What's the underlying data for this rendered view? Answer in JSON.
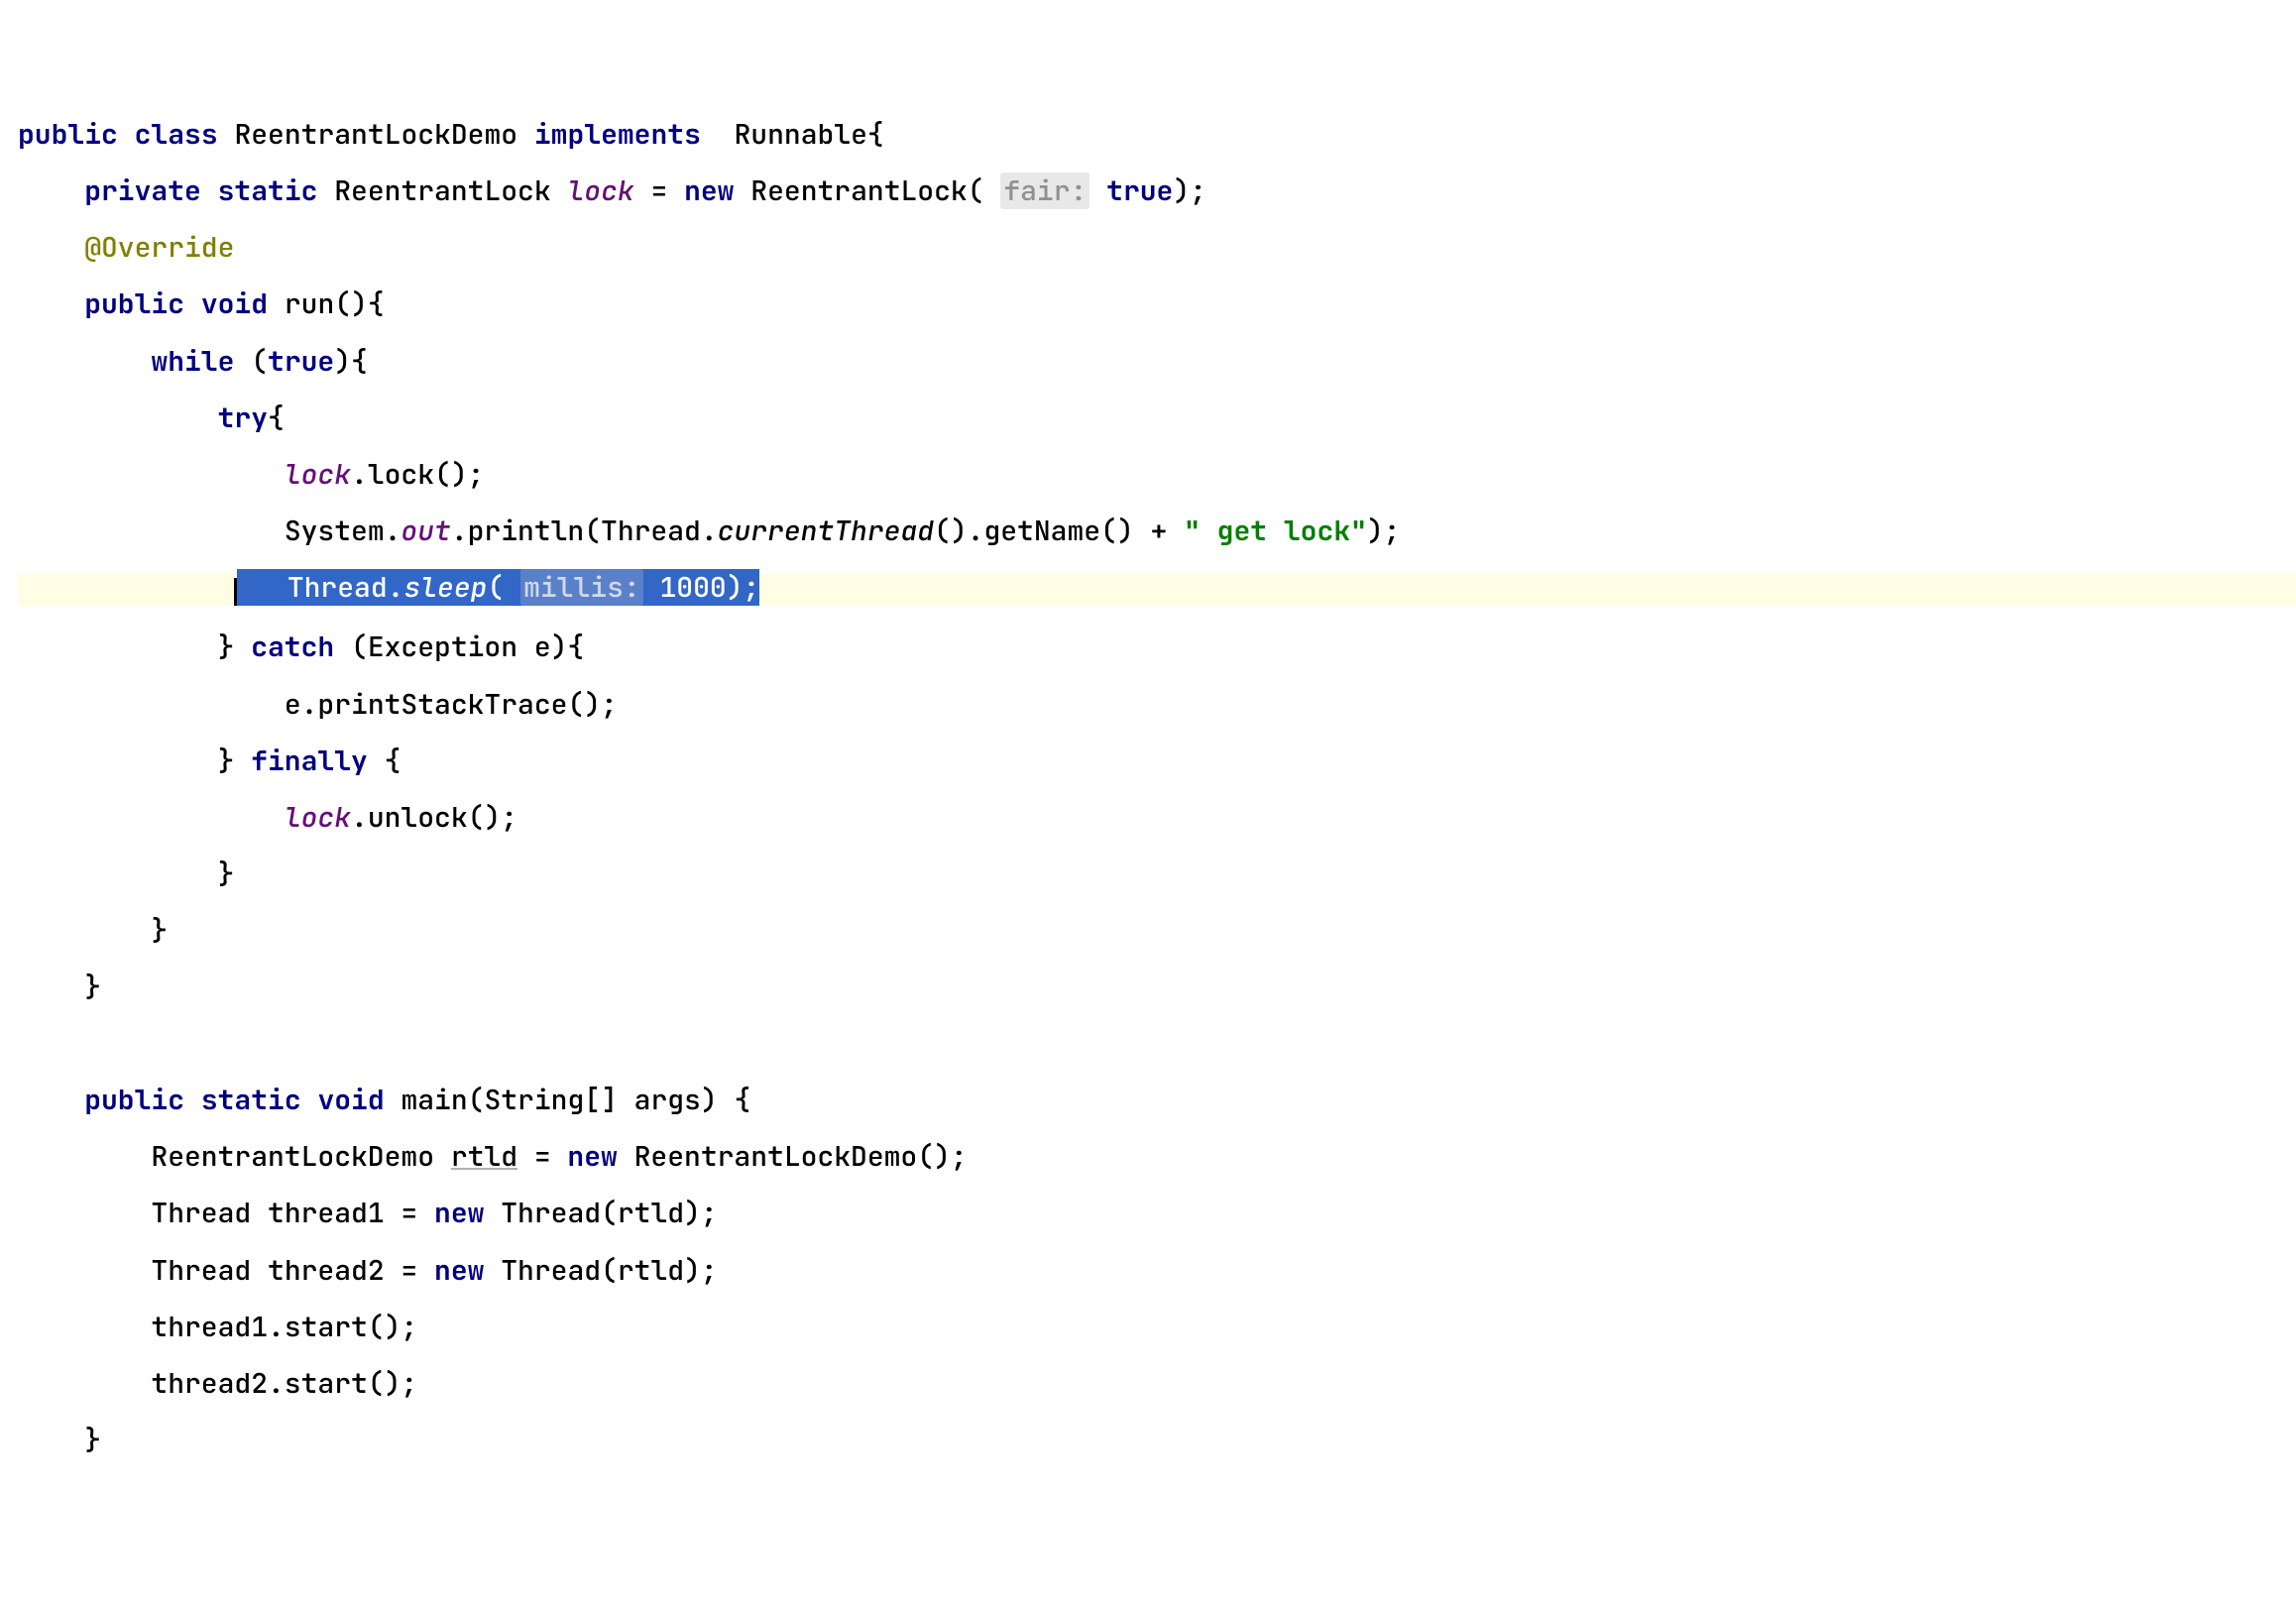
{
  "code": {
    "kw_public": "public",
    "kw_class": "class",
    "class_name": "ReentrantLockDemo",
    "kw_implements": "implements",
    "interface_name": "Runnable",
    "kw_private": "private",
    "kw_static": "static",
    "type_reentrantlock": "ReentrantLock",
    "field_lock": "lock",
    "eq": " = ",
    "kw_new": "new",
    "ctor_reentrantlock": "ReentrantLock",
    "hint_fair": "fair:",
    "val_true": "true",
    "annotation_override": "@Override",
    "kw_void": "void",
    "method_run": "run",
    "kw_while": "while",
    "kw_try": "try",
    "call_lock": ".lock();",
    "sysout_System": "System.",
    "sysout_out": "out",
    "sysout_println": ".println(Thread.",
    "currentThread": "currentThread",
    "getName_tail": "().getName() + ",
    "str_getlock": "\" get lock\"",
    "close_println": ");",
    "thread_word": "Thread",
    "dot": ".",
    "sleep_word": "sleep",
    "open_paren": "(",
    "hint_millis": "millis:",
    "sleep_val": "1000",
    "close_sleep": ");",
    "kw_catch": "catch",
    "catch_sig": " (Exception e){",
    "print_stack": "e.printStackTrace();",
    "kw_finally": "finally",
    "call_unlock": ".unlock();",
    "main_sig_pre": " main(String[] args) {",
    "main_line1_pre": "ReentrantLockDemo ",
    "main_var_rtld": "rtld",
    "main_line1_post": " ReentrantLockDemo();",
    "thread_decl_type": "Thread",
    "thread1_name": " thread1 = ",
    "thread2_name": " thread2 = ",
    "thread_ctor": " Thread(rtld);",
    "start1": "thread1.start();",
    "start2": "thread2.start();"
  }
}
